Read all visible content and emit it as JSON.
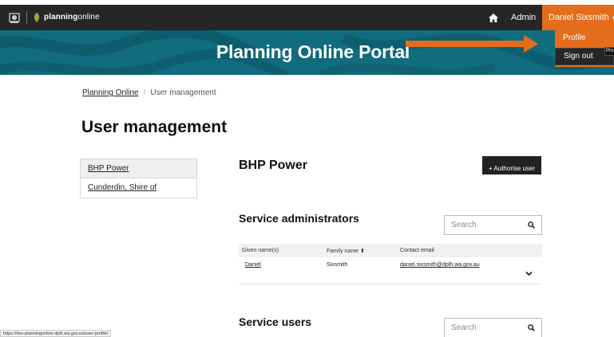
{
  "topbar": {
    "brand_bold": "planning",
    "brand_light": "online",
    "admin_label": "Admin",
    "user_name": "Daniel Sixsmith",
    "user_caret": "▾",
    "home_icon": "home-icon",
    "crest_icon": "wa-crest-icon",
    "logo_icon": "planningonline-logo-icon"
  },
  "banner": {
    "title": "Planning Online Portal",
    "bg_color": "#116c7e"
  },
  "user_menu": {
    "profile_label": "Profile",
    "signout_label": "Sign out",
    "tooltip": "Pro",
    "accent_color": "#e46d1c"
  },
  "breadcrumb": {
    "home": "Planning Online",
    "separator": "/",
    "current": "User management"
  },
  "page_title": "User management",
  "organisations": [
    {
      "label": "BHP Power"
    },
    {
      "label": "Cunderdin, Shire of"
    }
  ],
  "org_title": "BHP Power",
  "authorise_button": "+ Authorise user",
  "admins": {
    "title": "Service administrators",
    "search_placeholder": "Search",
    "columns": {
      "given": "Given name(s)",
      "family": "Family name",
      "email": "Contact email"
    },
    "sort_indicator": "🠕",
    "rows": [
      {
        "given": "Daniel",
        "family": "Sixsmith",
        "email": "daniel.sixsmith@dplh.wa.gov.au"
      }
    ]
  },
  "users": {
    "title": "Service users",
    "search_placeholder": "Search"
  },
  "status_url": "https://dev-planningonline.dplh.wa.gov.au/user-profile/"
}
